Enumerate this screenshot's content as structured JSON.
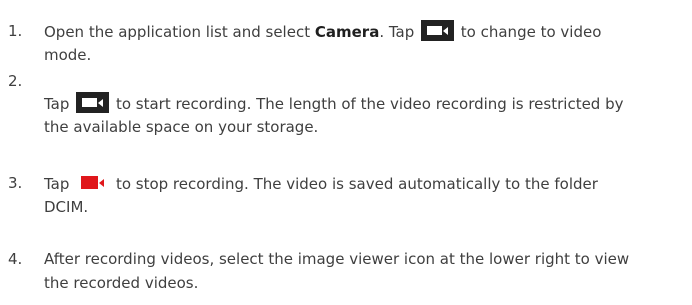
{
  "steps": [
    {
      "num": "1.",
      "line1_a": "Open the application list and select ",
      "line1_bold": "Camera",
      "line1_b": ". Tap ",
      "line1_c": " to change to video",
      "line2": "mode.",
      "icon": "video-mode-icon"
    },
    {
      "num": "2.",
      "line1_a": "Tap ",
      "line1_b": " to start recording. The length of the video recording is restricted by",
      "line2": "the available space on your storage.",
      "icon": "record-start-icon"
    },
    {
      "num": "3.",
      "line1_a": "Tap ",
      "line1_b": "  to stop recording. The video is saved automatically to the folder",
      "line2": "DCIM.",
      "icon": "record-stop-icon",
      "icon_color": "#e0171b"
    },
    {
      "num": "4.",
      "line1": "After recording videos, select the image viewer icon at the lower right to view",
      "line2": "the recorded videos."
    }
  ]
}
